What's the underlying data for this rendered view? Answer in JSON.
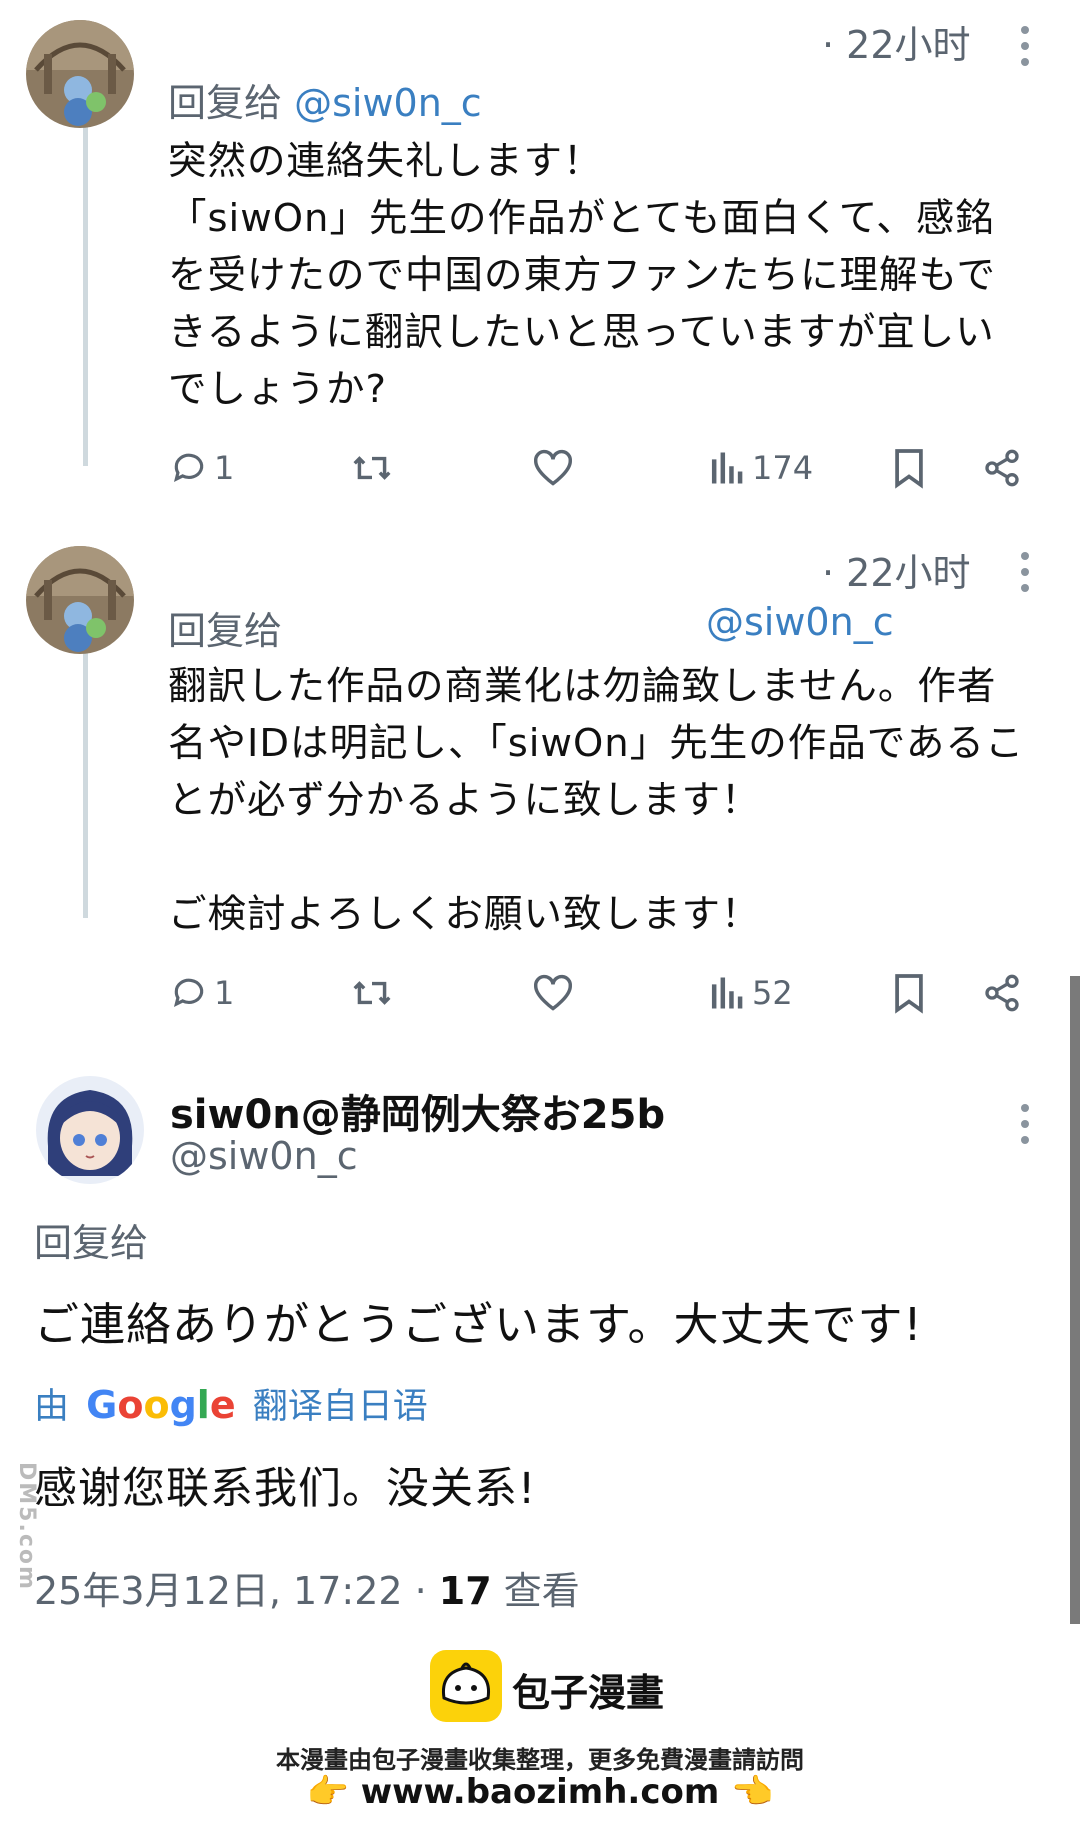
{
  "tweets": [
    {
      "time": "· 22小时",
      "reply_prefix": "回复给",
      "reply_handle": "@siw0n_c",
      "text": "突然の連絡失礼します！\n「siwOn」先生の作品がとても面白くて、感銘を受けたので中国の東方ファンたちに理解もできるように翻訳したいと思っていますが宜しいでしょうか?",
      "stats": {
        "replies": "1",
        "views": "174"
      }
    },
    {
      "time": "· 22小时",
      "reply_prefix": "回复给",
      "reply_handle": "@siw0n_c",
      "text": "翻訳した作品の商業化は勿論致しません。作者名やIDは明記し、「siwOn」先生の作品であることが必ず分かるように致します！\n\nご検討よろしくお願い致します！",
      "stats": {
        "replies": "1",
        "views": "52"
      }
    }
  ],
  "main_tweet": {
    "name": "siw0n@静岡例大祭お25b",
    "handle": "@siw0n_c",
    "reply_prefix": "回复给",
    "text": "ご連絡ありがとうございます。大丈夫です!",
    "translate_by": "由",
    "translate_brand": [
      "G",
      "o",
      "o",
      "g",
      "l",
      "e"
    ],
    "translate_suffix": "翻译自日语",
    "translated_text": "感谢您联系我们。没关系!",
    "date": "25年3月12日, 17:22 · ",
    "views_count": "17",
    "views_label": " 查看"
  },
  "watermark": "DM5.com",
  "footer": {
    "brand": "包子漫畫",
    "line1": "本漫畫由包子漫畫收集整理，更多免費漫畫請訪問",
    "url": "👉 www.baozimh.com 👈"
  },
  "icons": [
    "reply-icon",
    "retweet-icon",
    "like-icon",
    "views-icon",
    "bookmark-icon",
    "share-icon",
    "more-icon"
  ],
  "colors": {
    "link": "#3a7fc1",
    "muted": "#5b6570",
    "thread": "#cfd9de",
    "brand_yellow": "#fcd20a"
  }
}
